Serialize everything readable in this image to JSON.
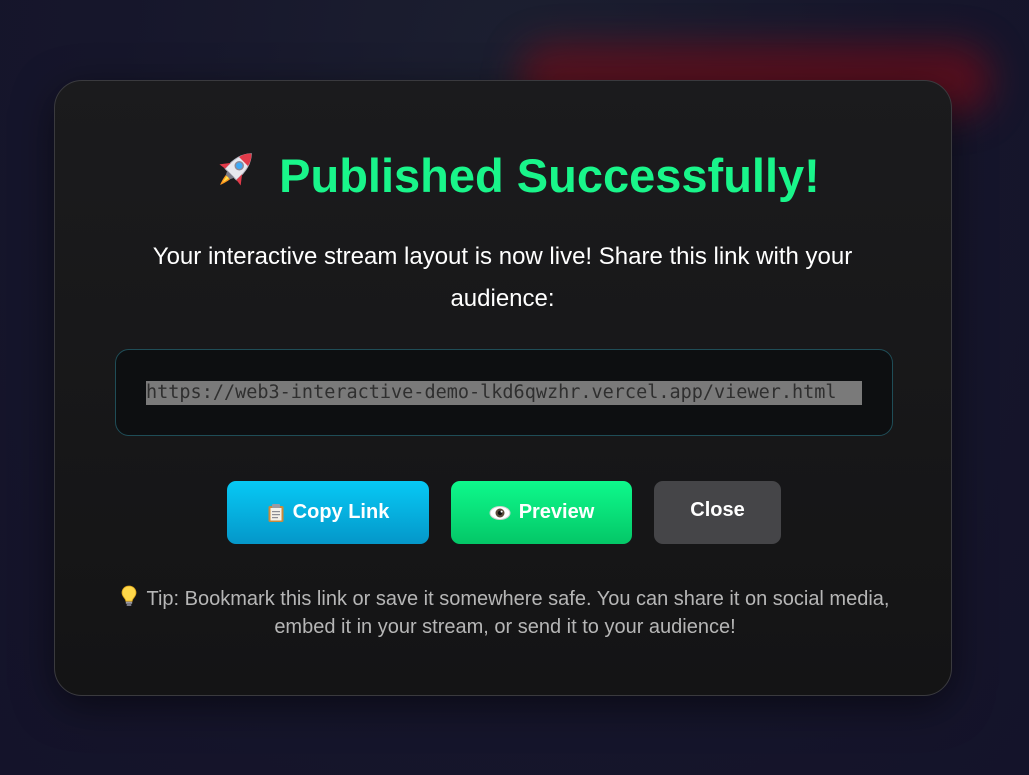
{
  "modal": {
    "title": "Published Successfully!",
    "title_icon": "rocket-icon",
    "message": "Your interactive stream layout is now live! Share this link with your audience:",
    "url": "https://web3-interactive-demo-lkd6qwzhr.vercel.app/viewer.html",
    "buttons": {
      "copy_label": "Copy Link",
      "copy_icon": "clipboard-icon",
      "preview_label": "Preview",
      "preview_icon": "eye-icon",
      "close_label": "Close"
    },
    "tip": "Tip: Bookmark this link or save it somewhere safe. You can share it on social media, embed it in your stream, or send it to your audience!",
    "tip_icon": "lightbulb-icon"
  },
  "colors": {
    "title": "#19f58a",
    "copy_button": "#06c9f5",
    "preview_button": "#0ef98c",
    "close_button": "#454548"
  }
}
